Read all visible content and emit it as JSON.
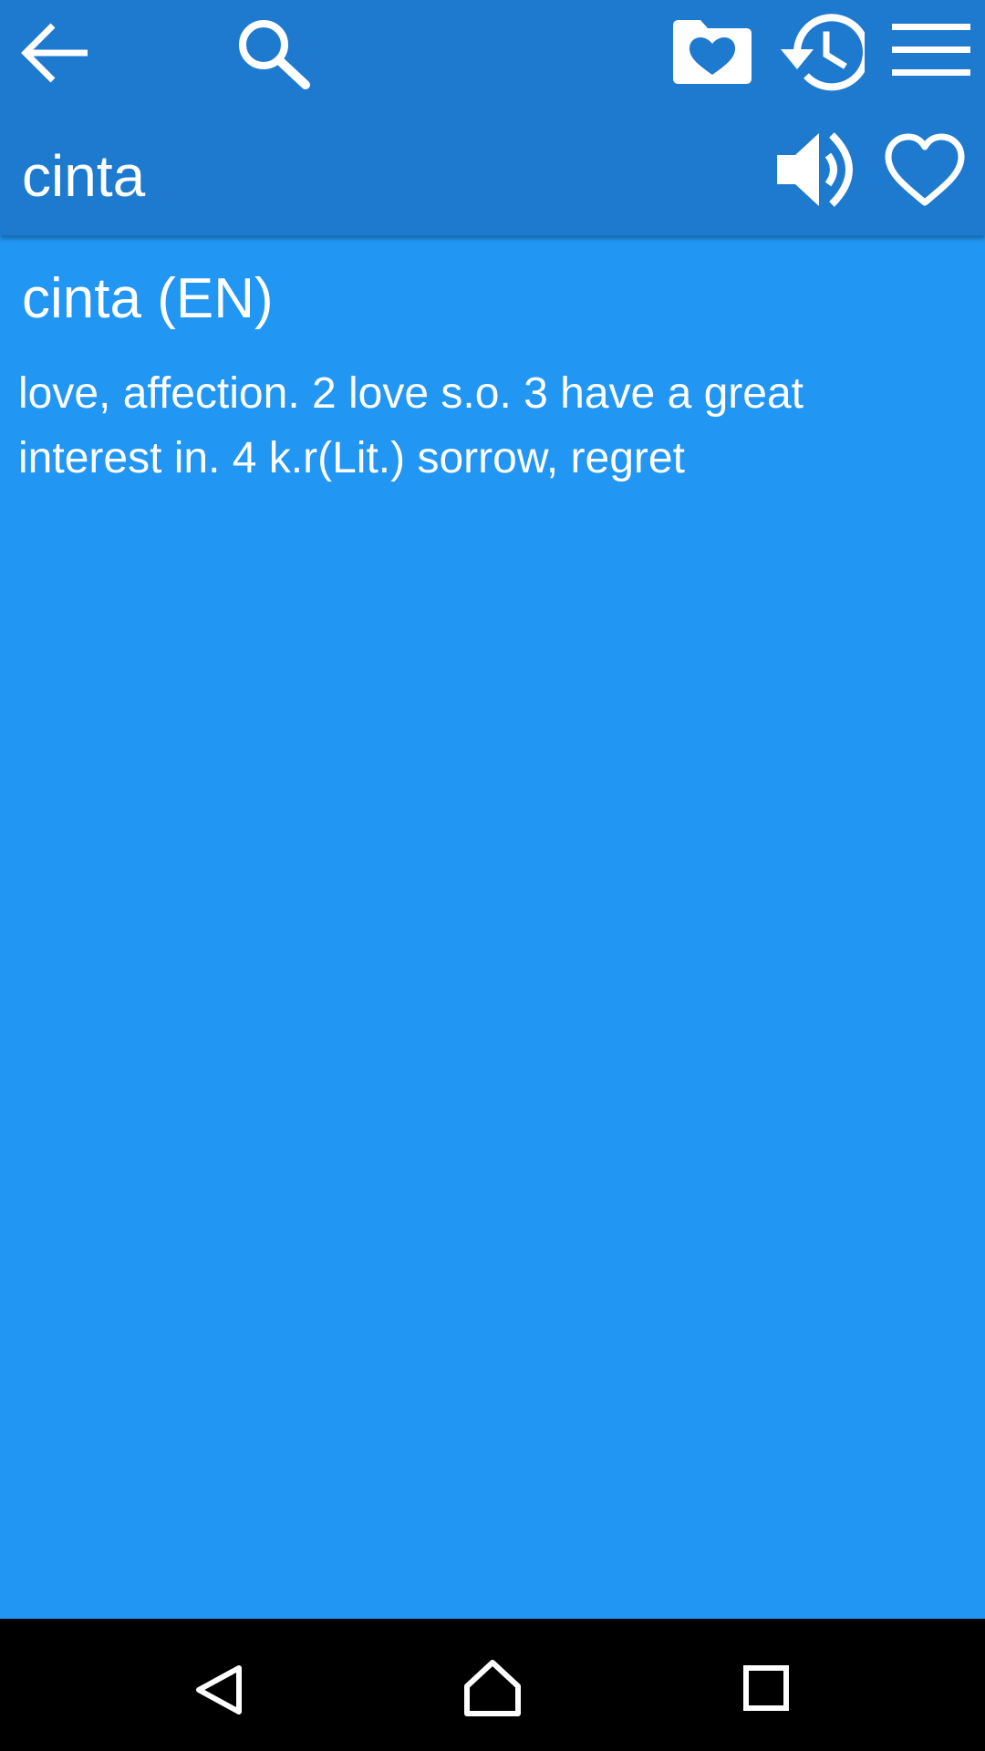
{
  "toolbar": {
    "icons": {
      "back": "arrow-back-icon",
      "search": "search-icon",
      "favorites": "favorites-folder-icon",
      "history": "history-icon",
      "menu": "menu-icon",
      "speak": "volume-icon",
      "favorite": "heart-outline-icon"
    },
    "word": "cinta"
  },
  "entry": {
    "heading": "cinta (EN)",
    "definition": "love, affection. 2 love s.o. 3 have a great interest in. 4 k.r(Lit.) sorrow, regret"
  },
  "navbar": {
    "icons": {
      "back": "nav-back-icon",
      "home": "nav-home-icon",
      "recents": "nav-recents-icon"
    }
  },
  "colors": {
    "toolbar": "#1E7ACF",
    "content": "#2196F3",
    "text": "#FFFFFF",
    "navbar": "#000000"
  }
}
